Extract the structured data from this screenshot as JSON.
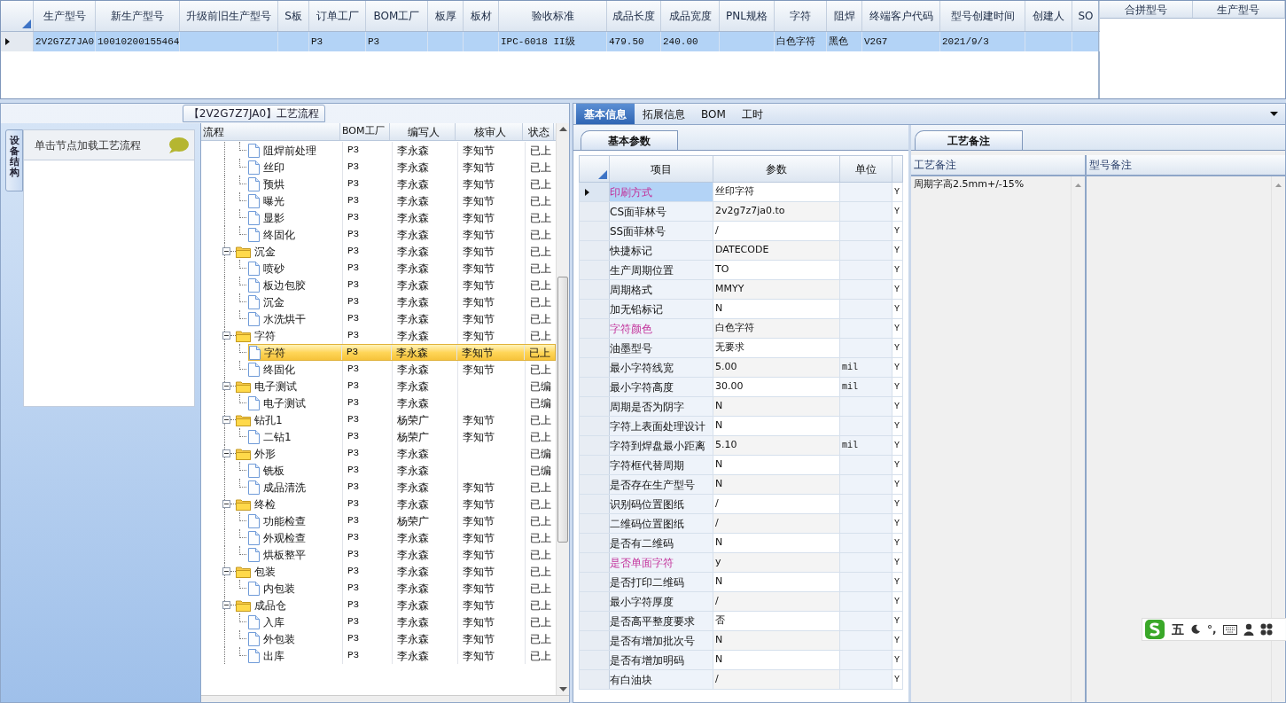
{
  "order_grid": {
    "columns": [
      "生产型号",
      "新生产型号",
      "升级前旧生产型号",
      "S板",
      "订单工厂",
      "BOM工厂",
      "板厚",
      "板材",
      "验收标准",
      "成品长度",
      "成品宽度",
      "PNL规格",
      "字符",
      "阻焊",
      "终端客户代码",
      "型号创建时间",
      "创建人",
      "SO"
    ],
    "rows": [
      {
        "selected": true,
        "cells": [
          "2V2G7Z7JA0",
          "10010200155464",
          null,
          null,
          "P3",
          "P3",
          null,
          null,
          "IPC-6018 II级",
          "479.50",
          "240.00",
          null,
          "白色字符",
          "黑色",
          "V2G7",
          "2021/9/3",
          null,
          null
        ]
      }
    ]
  },
  "merge_grid": {
    "columns": [
      "合拼型号",
      "生产型号"
    ]
  },
  "process_panel": {
    "title": "【2V2G7Z7JA0】工艺流程",
    "side_tab": "设备结构",
    "sidebar_header": "单击节点加载工艺流程",
    "tree": {
      "columns": [
        "流程",
        "BOM工厂",
        "编写人",
        "核审人",
        "状态"
      ],
      "nodes": [
        {
          "kind": "step",
          "name": "阻焊前处理",
          "bom": "P3",
          "author": "李永森",
          "reviewer": "李知节",
          "status": "已上",
          "selected": false
        },
        {
          "kind": "step",
          "name": "丝印",
          "bom": "P3",
          "author": "李永森",
          "reviewer": "李知节",
          "status": "已上",
          "selected": false
        },
        {
          "kind": "step",
          "name": "预烘",
          "bom": "P3",
          "author": "李永森",
          "reviewer": "李知节",
          "status": "已上",
          "selected": false
        },
        {
          "kind": "step",
          "name": "曝光",
          "bom": "P3",
          "author": "李永森",
          "reviewer": "李知节",
          "status": "已上",
          "selected": false
        },
        {
          "kind": "step",
          "name": "显影",
          "bom": "P3",
          "author": "李永森",
          "reviewer": "李知节",
          "status": "已上",
          "selected": false
        },
        {
          "kind": "step",
          "name": "终固化",
          "bom": "P3",
          "author": "李永森",
          "reviewer": "李知节",
          "status": "已上",
          "selected": false
        },
        {
          "kind": "group",
          "name": "沉金",
          "bom": "P3",
          "author": "李永森",
          "reviewer": "李知节",
          "status": "已上",
          "selected": false,
          "expanded": true,
          "children": [
            {
              "kind": "step",
              "name": "喷砂",
              "bom": "P3",
              "author": "李永森",
              "reviewer": "李知节",
              "status": "已上",
              "selected": false
            },
            {
              "kind": "step",
              "name": "板边包胶",
              "bom": "P3",
              "author": "李永森",
              "reviewer": "李知节",
              "status": "已上",
              "selected": false
            },
            {
              "kind": "step",
              "name": "沉金",
              "bom": "P3",
              "author": "李永森",
              "reviewer": "李知节",
              "status": "已上",
              "selected": false
            },
            {
              "kind": "step",
              "name": "水洗烘干",
              "bom": "P3",
              "author": "李永森",
              "reviewer": "李知节",
              "status": "已上",
              "selected": false
            }
          ]
        },
        {
          "kind": "group",
          "name": "字符",
          "bom": "P3",
          "author": "李永森",
          "reviewer": "李知节",
          "status": "已上",
          "selected": false,
          "expanded": true,
          "children": [
            {
              "kind": "step",
              "name": "字符",
              "bom": "P3",
              "author": "李永森",
              "reviewer": "李知节",
              "status": "已上",
              "selected": true
            },
            {
              "kind": "step",
              "name": "终固化",
              "bom": "P3",
              "author": "李永森",
              "reviewer": "李知节",
              "status": "已上",
              "selected": false
            }
          ]
        },
        {
          "kind": "group",
          "name": "电子测试",
          "bom": "P3",
          "author": "李永森",
          "status": "已编",
          "selected": false,
          "expanded": true,
          "children": [
            {
              "kind": "step",
              "name": "电子测试",
              "bom": "P3",
              "author": "李永森",
              "status": "已编",
              "selected": false
            }
          ]
        },
        {
          "kind": "group",
          "name": "钻孔1",
          "bom": "P3",
          "author": "杨荣广",
          "reviewer": "李知节",
          "status": "已上",
          "selected": false,
          "expanded": true,
          "children": [
            {
              "kind": "step",
              "name": "二钻1",
              "bom": "P3",
              "author": "杨荣广",
              "reviewer": "李知节",
              "status": "已上",
              "selected": false
            }
          ]
        },
        {
          "kind": "group",
          "name": "外形",
          "bom": "P3",
          "author": "李永森",
          "status": "已编",
          "selected": false,
          "expanded": true,
          "children": [
            {
              "kind": "step",
              "name": "铣板",
              "bom": "P3",
              "author": "李永森",
              "status": "已编",
              "selected": false
            },
            {
              "kind": "step",
              "name": "成品清洗",
              "bom": "P3",
              "author": "李永森",
              "reviewer": "李知节",
              "status": "已上",
              "selected": false
            }
          ]
        },
        {
          "kind": "group",
          "name": "终检",
          "bom": "P3",
          "author": "李永森",
          "reviewer": "李知节",
          "status": "已上",
          "selected": false,
          "expanded": true,
          "children": [
            {
              "kind": "step",
              "name": "功能检查",
              "bom": "P3",
              "author": "杨荣广",
              "reviewer": "李知节",
              "status": "已上",
              "selected": false
            },
            {
              "kind": "step",
              "name": "外观检查",
              "bom": "P3",
              "author": "李永森",
              "reviewer": "李知节",
              "status": "已上",
              "selected": false
            },
            {
              "kind": "step",
              "name": "烘板整平",
              "bom": "P3",
              "author": "李永森",
              "reviewer": "李知节",
              "status": "已上",
              "selected": false
            }
          ]
        },
        {
          "kind": "group",
          "name": "包装",
          "bom": "P3",
          "author": "李永森",
          "reviewer": "李知节",
          "status": "已上",
          "selected": false,
          "expanded": true,
          "children": [
            {
              "kind": "step",
              "name": "内包装",
              "bom": "P3",
              "author": "李永森",
              "reviewer": "李知节",
              "status": "已上",
              "selected": false
            }
          ]
        },
        {
          "kind": "group",
          "name": "成品仓",
          "bom": "P3",
          "author": "李永森",
          "reviewer": "李知节",
          "status": "已上",
          "selected": false,
          "expanded": true,
          "children": [
            {
              "kind": "step",
              "name": "入库",
              "bom": "P3",
              "author": "李永森",
              "reviewer": "李知节",
              "status": "已上",
              "selected": false
            },
            {
              "kind": "step",
              "name": "外包装",
              "bom": "P3",
              "author": "李永森",
              "reviewer": "李知节",
              "status": "已上",
              "selected": false
            },
            {
              "kind": "step",
              "name": "出库",
              "bom": "P3",
              "author": "李永森",
              "reviewer": "李知节",
              "status": "已上",
              "selected": false
            }
          ]
        }
      ]
    }
  },
  "detail_tabs": [
    {
      "label": "基本信息",
      "selected": true
    },
    {
      "label": "拓展信息",
      "selected": false
    },
    {
      "label": "BOM",
      "selected": false
    },
    {
      "label": "工时",
      "selected": false
    }
  ],
  "params": {
    "tab": "基本参数",
    "columns": [
      "项目",
      "参数",
      "单位"
    ],
    "rows": [
      {
        "item": "印刷方式",
        "value": "丝印字符",
        "flag": "Y",
        "emphasized": true,
        "selected": true
      },
      {
        "item": "CS面菲林号",
        "value": "2v2g7z7ja0.to",
        "flag": "Y",
        "emphasized": false,
        "selected": false
      },
      {
        "item": "SS面菲林号",
        "value": "/",
        "flag": "Y",
        "emphasized": false,
        "selected": false
      },
      {
        "item": "快捷标记",
        "value": "DATECODE",
        "flag": "Y",
        "emphasized": false,
        "selected": false
      },
      {
        "item": "生产周期位置",
        "value": "TO",
        "flag": "Y",
        "emphasized": false,
        "selected": false
      },
      {
        "item": "周期格式",
        "value": "MMYY",
        "flag": "Y",
        "emphasized": false,
        "selected": false
      },
      {
        "item": "加无铅标记",
        "value": "N",
        "flag": "Y",
        "emphasized": false,
        "selected": false
      },
      {
        "item": "字符颜色",
        "value": "白色字符",
        "flag": "Y",
        "emphasized": true,
        "selected": false
      },
      {
        "item": "油墨型号",
        "value": "无要求",
        "flag": "Y",
        "emphasized": false,
        "selected": false
      },
      {
        "item": "最小字符线宽",
        "value": "5.00",
        "unit": "mil",
        "flag": "Y",
        "emphasized": false,
        "selected": false
      },
      {
        "item": "最小字符高度",
        "value": "30.00",
        "unit": "mil",
        "flag": "Y",
        "emphasized": false,
        "selected": false
      },
      {
        "item": "周期是否为阴字",
        "value": "N",
        "flag": "Y",
        "emphasized": false,
        "selected": false
      },
      {
        "item": "字符上表面处理设计",
        "value": "N",
        "flag": "Y",
        "emphasized": false,
        "selected": false
      },
      {
        "item": "字符到焊盘最小距离",
        "value": "5.10",
        "unit": "mil",
        "flag": "Y",
        "emphasized": false,
        "selected": false
      },
      {
        "item": "字符框代替周期",
        "value": "N",
        "flag": "Y",
        "emphasized": false,
        "selected": false
      },
      {
        "item": "是否存在生产型号",
        "value": "N",
        "flag": "Y",
        "emphasized": false,
        "selected": false
      },
      {
        "item": "识别码位置图纸",
        "value": "/",
        "flag": "Y",
        "emphasized": false,
        "selected": false
      },
      {
        "item": "二维码位置图纸",
        "value": "/",
        "flag": "Y",
        "emphasized": false,
        "selected": false
      },
      {
        "item": "是否有二维码",
        "value": "N",
        "flag": "Y",
        "emphasized": false,
        "selected": false
      },
      {
        "item": "是否单面字符",
        "value": "y",
        "flag": "Y",
        "emphasized": true,
        "selected": false
      },
      {
        "item": "是否打印二维码",
        "value": "N",
        "flag": "Y",
        "emphasized": false,
        "selected": false
      },
      {
        "item": "最小字符厚度",
        "value": "/",
        "flag": "Y",
        "emphasized": false,
        "selected": false
      },
      {
        "item": "是否高平整度要求",
        "value": "否",
        "flag": "Y",
        "emphasized": false,
        "selected": false
      },
      {
        "item": "是否有增加批次号",
        "value": "N",
        "flag": "Y",
        "emphasized": false,
        "selected": false
      },
      {
        "item": "是否有增加明码",
        "value": "N",
        "flag": "Y",
        "emphasized": false,
        "selected": false
      },
      {
        "item": "有白油块",
        "value": "/",
        "flag": "Y",
        "emphasized": false,
        "selected": false
      }
    ]
  },
  "remarks": {
    "tab": "工艺备注",
    "columns": [
      "工艺备注",
      "型号备注"
    ],
    "process_note": "周期字高2.5mm+/-15%"
  },
  "ime_bar": {
    "mode": "五",
    "punctuation": "°,"
  }
}
